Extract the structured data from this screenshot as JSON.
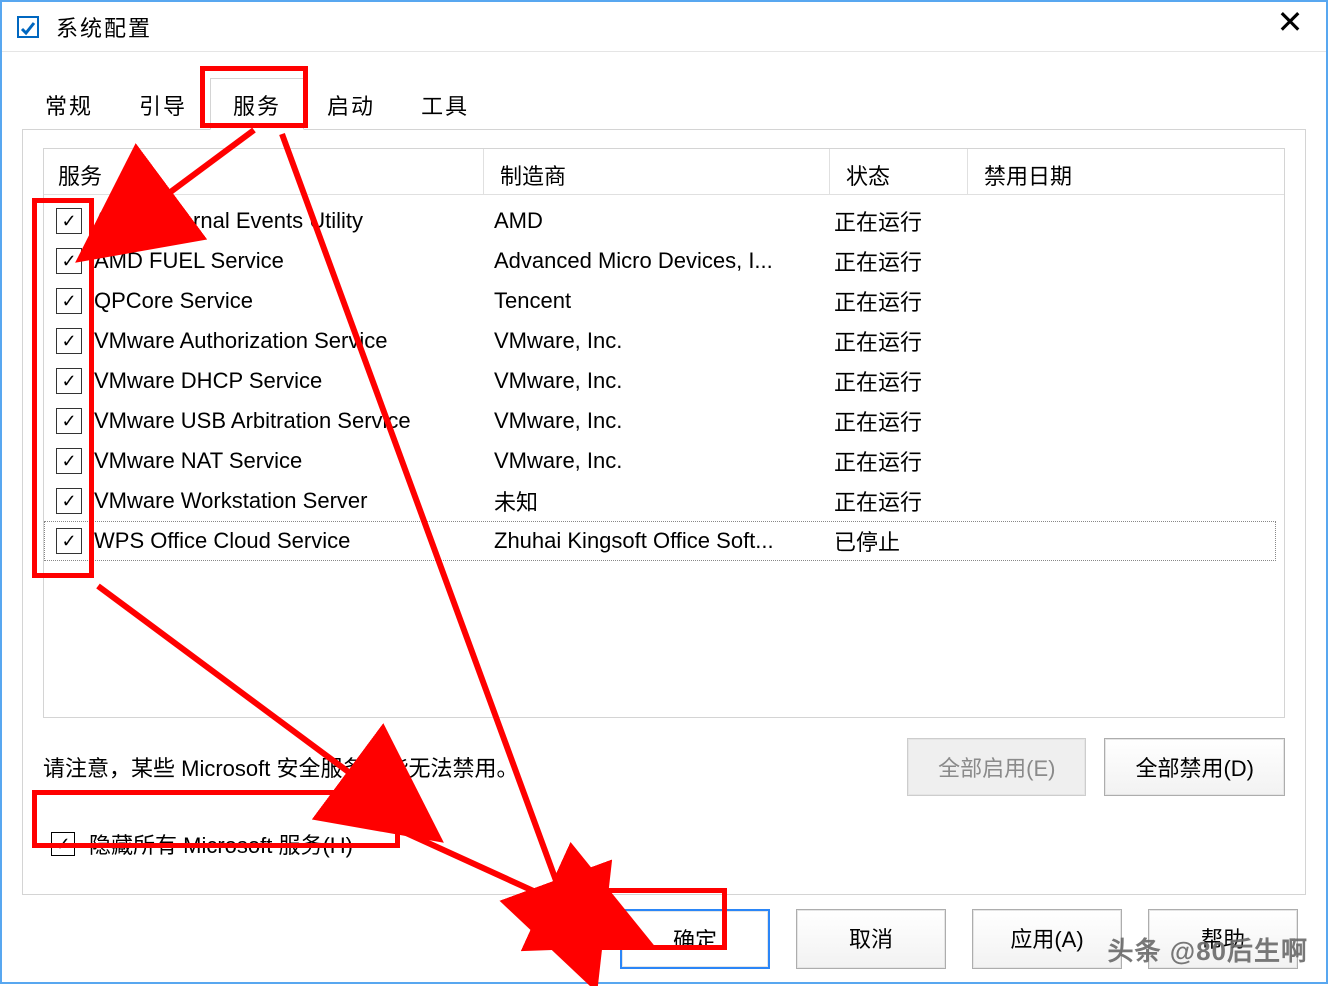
{
  "titlebar": {
    "title": "系统配置"
  },
  "tabs": {
    "items": [
      "常规",
      "引导",
      "服务",
      "启动",
      "工具"
    ],
    "active_index": 2
  },
  "columns": {
    "service": "服务",
    "manufacturer": "制造商",
    "status": "状态",
    "disabled_date": "禁用日期"
  },
  "services": [
    {
      "checked": true,
      "name": "AMD External Events Utility",
      "manufacturer": "AMD",
      "status": "正在运行",
      "focused": false
    },
    {
      "checked": true,
      "name": "AMD FUEL Service",
      "manufacturer": "Advanced Micro Devices, I...",
      "status": "正在运行",
      "focused": false
    },
    {
      "checked": true,
      "name": "QPCore Service",
      "manufacturer": "Tencent",
      "status": "正在运行",
      "focused": false
    },
    {
      "checked": true,
      "name": "VMware Authorization Service",
      "manufacturer": "VMware, Inc.",
      "status": "正在运行",
      "focused": false
    },
    {
      "checked": true,
      "name": "VMware DHCP Service",
      "manufacturer": "VMware, Inc.",
      "status": "正在运行",
      "focused": false
    },
    {
      "checked": true,
      "name": "VMware USB Arbitration Service",
      "manufacturer": "VMware, Inc.",
      "status": "正在运行",
      "focused": false
    },
    {
      "checked": true,
      "name": "VMware NAT Service",
      "manufacturer": "VMware, Inc.",
      "status": "正在运行",
      "focused": false
    },
    {
      "checked": true,
      "name": "VMware Workstation Server",
      "manufacturer": "未知",
      "status": "正在运行",
      "focused": false
    },
    {
      "checked": true,
      "name": "WPS Office Cloud Service",
      "manufacturer": "Zhuhai Kingsoft Office Soft...",
      "status": "已停止",
      "focused": true
    }
  ],
  "panel": {
    "note": "请注意，某些 Microsoft 安全服务可能无法禁用。",
    "enable_all": "全部启用(E)",
    "disable_all": "全部禁用(D)",
    "hide_ms_label": "隐藏所有 Microsoft 服务(H)",
    "hide_ms_checked": true
  },
  "buttons": {
    "ok": "确定",
    "cancel": "取消",
    "apply": "应用(A)",
    "help": "帮助"
  },
  "watermark": "头条 @80后生啊"
}
